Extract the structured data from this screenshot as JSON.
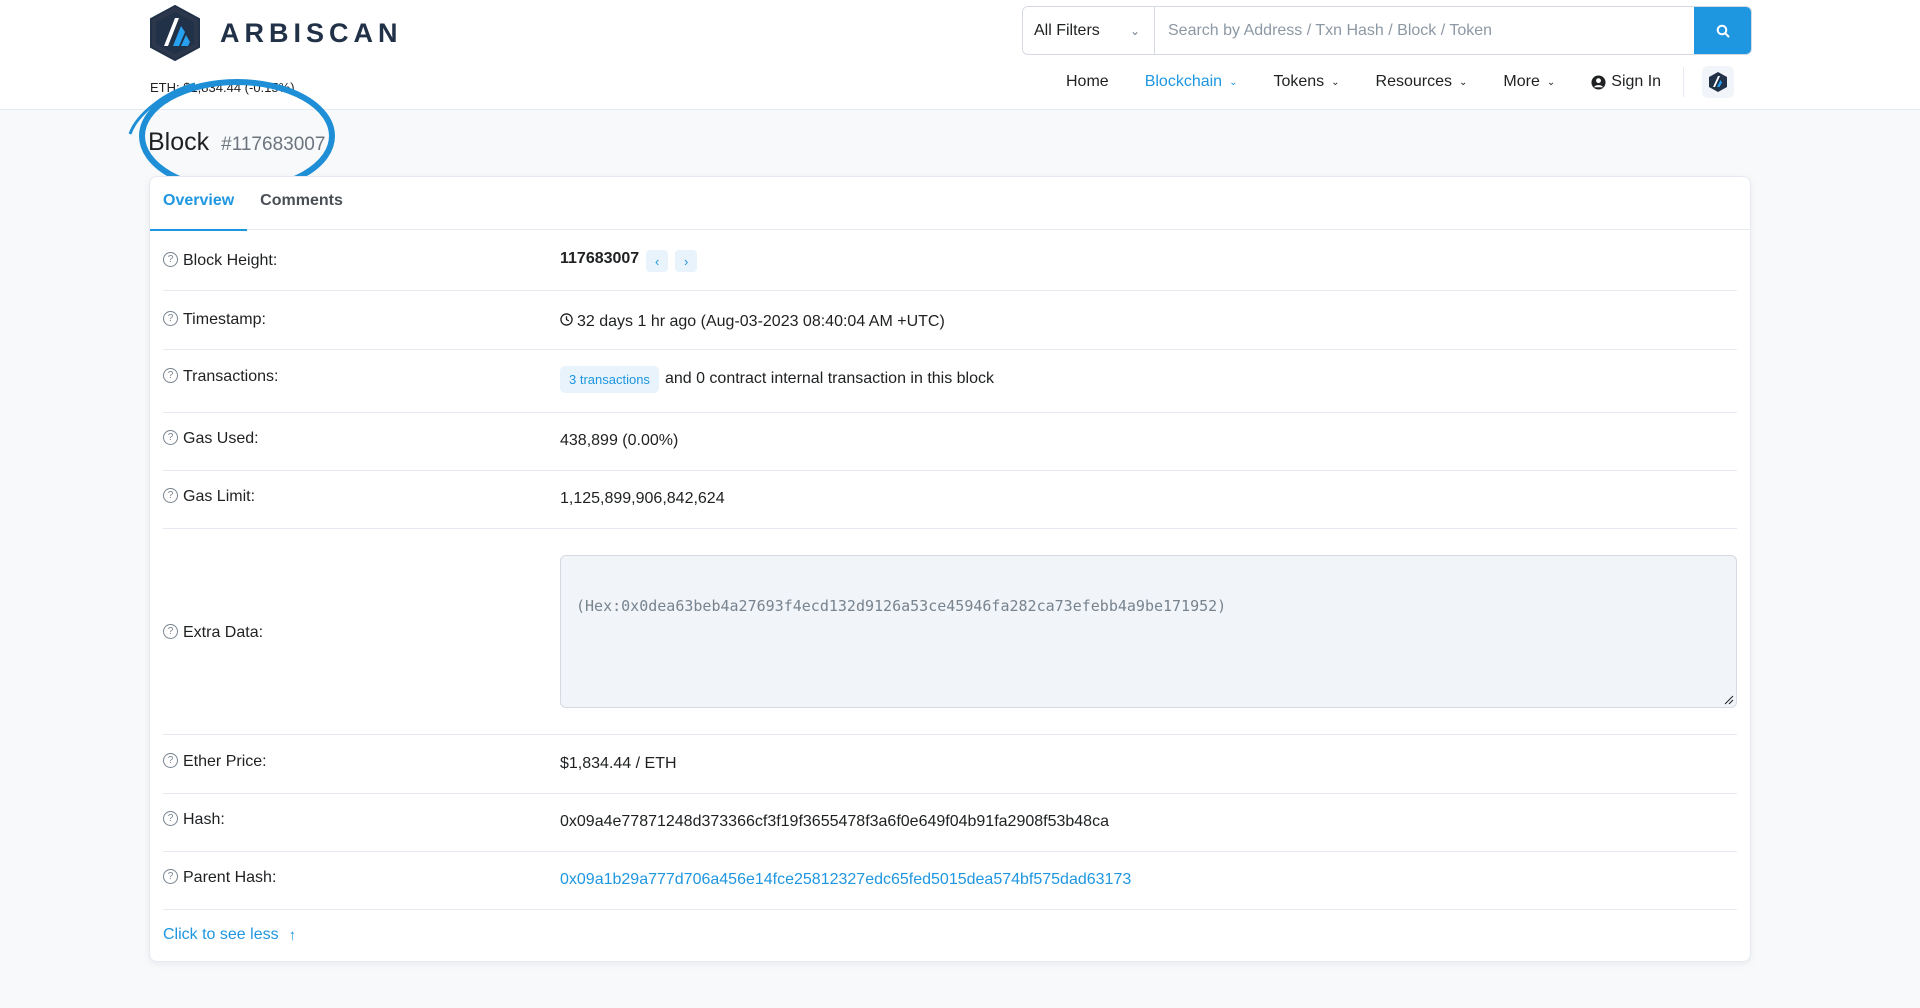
{
  "brand": {
    "name": "ARBISCAN",
    "eth_price_text": "ETH: $1,834.44 (-0.15%)"
  },
  "search": {
    "filter_selected": "All Filters",
    "placeholder": "Search by Address / Txn Hash / Block / Token",
    "value": ""
  },
  "nav": {
    "items": [
      {
        "label": "Home",
        "active": false,
        "dropdown": false
      },
      {
        "label": "Blockchain",
        "active": true,
        "dropdown": true
      },
      {
        "label": "Tokens",
        "active": false,
        "dropdown": true
      },
      {
        "label": "Resources",
        "active": false,
        "dropdown": true
      },
      {
        "label": "More",
        "active": false,
        "dropdown": true
      }
    ],
    "sign_in": "Sign In"
  },
  "page": {
    "title": "Block",
    "block_number": "#117683007"
  },
  "tabs": [
    {
      "label": "Overview",
      "active": true
    },
    {
      "label": "Comments",
      "active": false
    }
  ],
  "overview": {
    "block_height": {
      "label": "Block Height:",
      "value": "117683007"
    },
    "timestamp": {
      "label": "Timestamp:",
      "value": "32 days 1 hr ago (Aug-03-2023 08:40:04 AM +UTC)"
    },
    "transactions": {
      "label": "Transactions:",
      "badge": "3 transactions",
      "suffix": "and 0 contract internal transaction in this block"
    },
    "gas_used": {
      "label": "Gas Used:",
      "value": "438,899 (0.00%)"
    },
    "gas_limit": {
      "label": "Gas Limit:",
      "value": "1,125,899,906,842,624"
    },
    "extra_data": {
      "label": "Extra Data:",
      "value": "(Hex:0x0dea63beb4a27693f4ecd132d9126a53ce45946fa282ca73efebb4a9be171952)"
    },
    "ether_price": {
      "label": "Ether Price:",
      "value": "$1,834.44 / ETH"
    },
    "hash": {
      "label": "Hash:",
      "value": "0x09a4e77871248d373366cf3f19f3655478f3a6f0e649f04b91fa2908f53b48ca"
    },
    "parent_hash": {
      "label": "Parent Hash:",
      "value": "0x09a1b29a777d706a456e14fce25812327edc65fed5015dea574bf575dad63173"
    }
  },
  "see_less": "Click to see less",
  "colors": {
    "accent": "#1e96e0",
    "text": "#1e2022",
    "muted": "#77838f",
    "annotation": "#1e8fd6"
  }
}
